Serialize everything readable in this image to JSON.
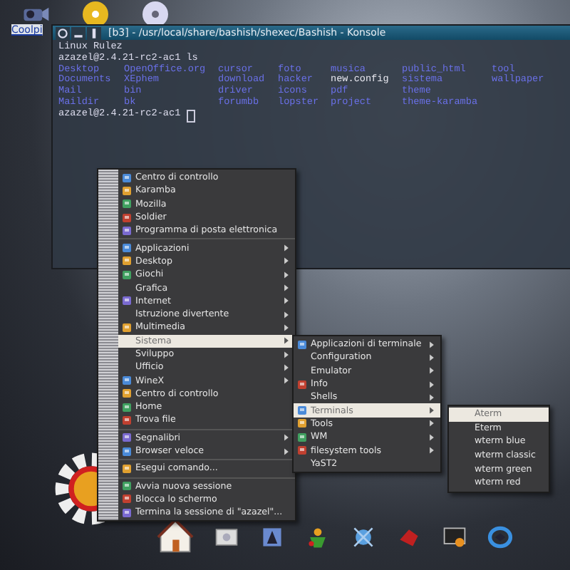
{
  "desktop_icons": [
    {
      "label": "Coolpi"
    }
  ],
  "terminal": {
    "title": "[b3] - /usr/local/share/bashish/shexec/Bashish - Konsole",
    "lines": [
      "Linux Rulez",
      "azazel@2.4.21-rc2-ac1 ls"
    ],
    "listing": [
      [
        {
          "text": "Desktop",
          "kind": "dir"
        },
        {
          "text": "Documents",
          "kind": "dir"
        },
        {
          "text": "Mail",
          "kind": "dir"
        },
        {
          "text": "Maildir",
          "kind": "dir"
        }
      ],
      [
        {
          "text": "OpenOffice.org",
          "kind": "dir"
        },
        {
          "text": "XEphem",
          "kind": "dir"
        },
        {
          "text": "bin",
          "kind": "dir"
        },
        {
          "text": "bk",
          "kind": "dir"
        }
      ],
      [
        {
          "text": "cursor",
          "kind": "dir"
        },
        {
          "text": "download",
          "kind": "dir"
        },
        {
          "text": "driver",
          "kind": "dir"
        },
        {
          "text": "forumbb",
          "kind": "dir"
        }
      ],
      [
        {
          "text": "foto",
          "kind": "dir"
        },
        {
          "text": "hacker",
          "kind": "dir"
        },
        {
          "text": "icons",
          "kind": "dir"
        },
        {
          "text": "lopster",
          "kind": "dir"
        }
      ],
      [
        {
          "text": "musica",
          "kind": "dir"
        },
        {
          "text": "new.config",
          "kind": "file"
        },
        {
          "text": "pdf",
          "kind": "dir"
        },
        {
          "text": "project",
          "kind": "dir"
        }
      ],
      [
        {
          "text": "public_html",
          "kind": "dir"
        },
        {
          "text": "sistema",
          "kind": "dir"
        },
        {
          "text": "theme",
          "kind": "dir"
        },
        {
          "text": "theme-karamba",
          "kind": "dir"
        }
      ],
      [
        {
          "text": "tool",
          "kind": "dir"
        },
        {
          "text": "wallpaper",
          "kind": "dir"
        }
      ]
    ],
    "prompt": "azazel@2.4.21-rc2-ac1"
  },
  "main_menu": {
    "sections": [
      [
        {
          "label": "Centro di controllo",
          "icon": true,
          "submenu": false,
          "selected": false
        },
        {
          "label": "Karamba",
          "icon": true,
          "submenu": false,
          "selected": false
        },
        {
          "label": "Mozilla",
          "icon": true,
          "submenu": false,
          "selected": false
        },
        {
          "label": "Soldier",
          "icon": true,
          "submenu": false,
          "selected": false
        },
        {
          "label": "Programma di posta elettronica",
          "icon": true,
          "submenu": false,
          "selected": false
        }
      ],
      [
        {
          "label": "Applicazioni",
          "icon": true,
          "submenu": true,
          "selected": false
        },
        {
          "label": "Desktop",
          "icon": true,
          "submenu": true,
          "selected": false
        },
        {
          "label": "Giochi",
          "icon": true,
          "submenu": true,
          "selected": false
        },
        {
          "label": "Grafica",
          "icon": false,
          "submenu": true,
          "selected": false
        },
        {
          "label": "Internet",
          "icon": true,
          "submenu": true,
          "selected": false
        },
        {
          "label": "Istruzione divertente",
          "icon": false,
          "submenu": true,
          "selected": false
        },
        {
          "label": "Multimedia",
          "icon": true,
          "submenu": true,
          "selected": false
        },
        {
          "label": "Sistema",
          "icon": false,
          "submenu": true,
          "selected": true
        },
        {
          "label": "Sviluppo",
          "icon": false,
          "submenu": true,
          "selected": false
        },
        {
          "label": "Ufficio",
          "icon": false,
          "submenu": true,
          "selected": false
        },
        {
          "label": "WineX",
          "icon": true,
          "submenu": true,
          "selected": false
        },
        {
          "label": "Centro di controllo",
          "icon": true,
          "submenu": false,
          "selected": false
        },
        {
          "label": "Home",
          "icon": true,
          "submenu": false,
          "selected": false
        },
        {
          "label": "Trova file",
          "icon": true,
          "submenu": false,
          "selected": false
        }
      ],
      [
        {
          "label": "Segnalibri",
          "icon": true,
          "submenu": true,
          "selected": false
        },
        {
          "label": "Browser veloce",
          "icon": true,
          "submenu": true,
          "selected": false
        }
      ],
      [
        {
          "label": "Esegui comando...",
          "icon": true,
          "submenu": false,
          "selected": false
        }
      ],
      [
        {
          "label": "Avvia nuova sessione",
          "icon": true,
          "submenu": false,
          "selected": false
        },
        {
          "label": "Blocca lo schermo",
          "icon": true,
          "submenu": false,
          "selected": false
        },
        {
          "label": "Termina la sessione di \"azazel\"...",
          "icon": true,
          "submenu": false,
          "selected": false
        }
      ]
    ]
  },
  "sistema_menu": {
    "sections": [
      [
        {
          "label": "Applicazioni di terminale",
          "icon": true,
          "submenu": true,
          "selected": false
        },
        {
          "label": "Configuration",
          "icon": false,
          "submenu": true,
          "selected": false
        },
        {
          "label": "Emulator",
          "icon": false,
          "submenu": true,
          "selected": false
        },
        {
          "label": "Info",
          "icon": true,
          "submenu": true,
          "selected": false
        },
        {
          "label": "Shells",
          "icon": false,
          "submenu": true,
          "selected": false
        },
        {
          "label": "Terminals",
          "icon": true,
          "submenu": true,
          "selected": true
        },
        {
          "label": "Tools",
          "icon": true,
          "submenu": true,
          "selected": false
        },
        {
          "label": "WM",
          "icon": true,
          "submenu": true,
          "selected": false
        },
        {
          "label": "filesystem tools",
          "icon": true,
          "submenu": true,
          "selected": false
        },
        {
          "label": "YaST2",
          "icon": false,
          "submenu": false,
          "selected": false
        }
      ]
    ]
  },
  "terminals_menu": {
    "sections": [
      [
        {
          "label": "Aterm",
          "icon": false,
          "submenu": false,
          "selected": true
        },
        {
          "label": "Eterm",
          "icon": false,
          "submenu": false,
          "selected": false
        },
        {
          "label": "wterm blue",
          "icon": false,
          "submenu": false,
          "selected": false
        },
        {
          "label": "wterm classic",
          "icon": false,
          "submenu": false,
          "selected": false
        },
        {
          "label": "wterm green",
          "icon": false,
          "submenu": false,
          "selected": false
        },
        {
          "label": "wterm red",
          "icon": false,
          "submenu": false,
          "selected": false
        }
      ]
    ]
  }
}
